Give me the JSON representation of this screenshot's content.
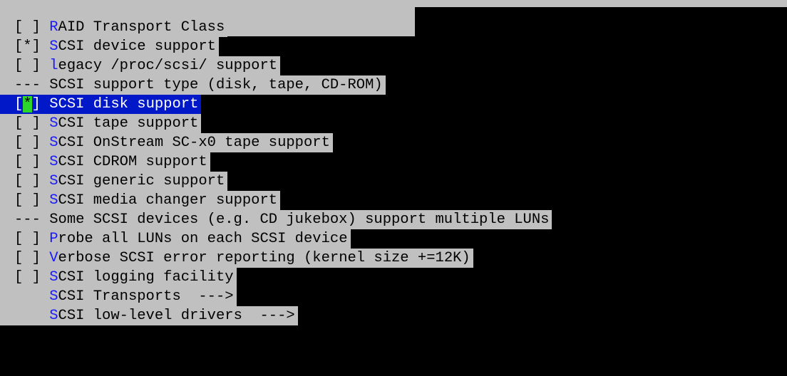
{
  "colors": {
    "background": "#000000",
    "panel": "#c0c0c0",
    "text": "#000000",
    "hotkey": "#1818ff",
    "selected_bg": "#0018c8",
    "selected_text": "#ffffff",
    "cursor": "#2bd52b"
  },
  "menu": {
    "items": [
      {
        "prefix": "[ ]",
        "hotkey": "R",
        "rest": "AID Transport Class",
        "selected": false
      },
      {
        "prefix": "[*]",
        "hotkey": "S",
        "rest": "CSI device support",
        "selected": false
      },
      {
        "prefix": "[ ]",
        "hotkey": "l",
        "rest": "egacy /proc/scsi/ support",
        "selected": false
      },
      {
        "prefix": "---",
        "hotkey": "",
        "rest": "SCSI support type (disk, tape, CD-ROM)",
        "selected": false
      },
      {
        "prefix": "[*]",
        "hotkey": "S",
        "rest": "CSI disk support",
        "selected": true
      },
      {
        "prefix": "[ ]",
        "hotkey": "S",
        "rest": "CSI tape support",
        "selected": false
      },
      {
        "prefix": "[ ]",
        "hotkey": "S",
        "rest": "CSI OnStream SC-x0 tape support",
        "selected": false
      },
      {
        "prefix": "[ ]",
        "hotkey": "S",
        "rest": "CSI CDROM support",
        "selected": false
      },
      {
        "prefix": "[ ]",
        "hotkey": "S",
        "rest": "CSI generic support",
        "selected": false
      },
      {
        "prefix": "[ ]",
        "hotkey": "S",
        "rest": "CSI media changer support",
        "selected": false
      },
      {
        "prefix": "---",
        "hotkey": "",
        "rest": "Some SCSI devices (e.g. CD jukebox) support multiple LUNs",
        "selected": false
      },
      {
        "prefix": "[ ]",
        "hotkey": "P",
        "rest": "robe all LUNs on each SCSI device",
        "selected": false
      },
      {
        "prefix": "[ ]",
        "hotkey": "V",
        "rest": "erbose SCSI error reporting (kernel size +=12K)",
        "selected": false
      },
      {
        "prefix": "[ ]",
        "hotkey": "S",
        "rest": "CSI logging facility",
        "selected": false
      },
      {
        "prefix": "   ",
        "hotkey": "S",
        "rest": "CSI Transports  --->",
        "selected": false
      },
      {
        "prefix": "   ",
        "hotkey": "S",
        "rest": "CSI low-level drivers  --->",
        "selected": false
      }
    ]
  }
}
